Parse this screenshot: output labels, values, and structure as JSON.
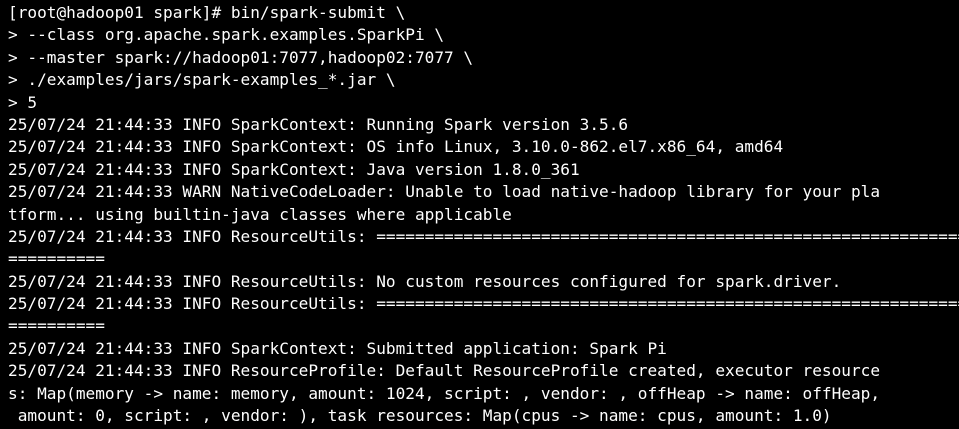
{
  "terminal": {
    "lines": [
      "[root@hadoop01 spark]# bin/spark-submit \\",
      "> --class org.apache.spark.examples.SparkPi \\",
      "> --master spark://hadoop01:7077,hadoop02:7077 \\",
      "> ./examples/jars/spark-examples_*.jar \\",
      "> 5",
      "25/07/24 21:44:33 INFO SparkContext: Running Spark version 3.5.6",
      "25/07/24 21:44:33 INFO SparkContext: OS info Linux, 3.10.0-862.el7.x86_64, amd64",
      "25/07/24 21:44:33 INFO SparkContext: Java version 1.8.0_361",
      "25/07/24 21:44:33 WARN NativeCodeLoader: Unable to load native-hadoop library for your pla",
      "tform... using builtin-java classes where applicable",
      "25/07/24 21:44:33 INFO ResourceUtils: =============================================================",
      "==========",
      "25/07/24 21:44:33 INFO ResourceUtils: No custom resources configured for spark.driver.",
      "25/07/24 21:44:33 INFO ResourceUtils: =============================================================",
      "==========",
      "25/07/24 21:44:33 INFO SparkContext: Submitted application: Spark Pi",
      "25/07/24 21:44:33 INFO ResourceProfile: Default ResourceProfile created, executor resource",
      "s: Map(memory -> name: memory, amount: 1024, script: , vendor: , offHeap -> name: offHeap,",
      " amount: 0, script: , vendor: ), task resources: Map(cpus -> name: cpus, amount: 1.0)"
    ]
  }
}
